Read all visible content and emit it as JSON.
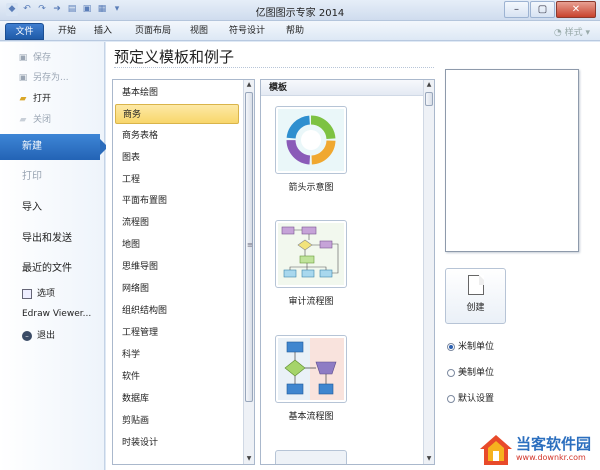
{
  "window": {
    "title": "亿图图示专家 2014",
    "controls": {
      "minimize": "–",
      "maximize": "▢",
      "close": "✕"
    }
  },
  "ribbon": {
    "tabs": [
      "文件",
      "开始",
      "插入",
      "页面布局",
      "视图",
      "符号设计",
      "帮助"
    ],
    "right_label": "样式"
  },
  "sidebar": {
    "save": "保存",
    "save_as": "另存为...",
    "open": "打开",
    "close": "关闭",
    "new": "新建",
    "print": "打印",
    "import": "导入",
    "export_send": "导出和发送",
    "recent": "最近的文件",
    "options": "选项",
    "viewer": "Edraw Viewer...",
    "exit": "退出"
  },
  "main": {
    "heading": "预定义模板和例子",
    "categories": [
      "基本绘图",
      "商务",
      "商务表格",
      "图表",
      "工程",
      "平面布置图",
      "流程图",
      "地图",
      "思维导图",
      "网络图",
      "组织结构图",
      "工程管理",
      "科学",
      "软件",
      "数据库",
      "剪贴画",
      "时装设计"
    ],
    "selected_category": "商务",
    "templates_header": "模板",
    "templates": [
      {
        "label": "箭头示意图",
        "icon": "cycle-arrows-thumbnail"
      },
      {
        "label": "审计流程图",
        "icon": "audit-flowchart-thumbnail"
      },
      {
        "label": "基本流程图",
        "icon": "basic-flowchart-thumbnail"
      }
    ]
  },
  "right": {
    "create_label": "创建",
    "units": [
      "米制单位",
      "美制单位",
      "默认设置"
    ],
    "selected_unit": "米制单位"
  },
  "watermark": {
    "brand": "当客软件园",
    "url": "www.downkr.com"
  },
  "colors": {
    "accent": "#2b6cbc",
    "selection": "#f8d66b",
    "cycle_green": "#7dc242",
    "cycle_blue": "#2f8fcf",
    "cycle_purple": "#8a5bb8"
  }
}
